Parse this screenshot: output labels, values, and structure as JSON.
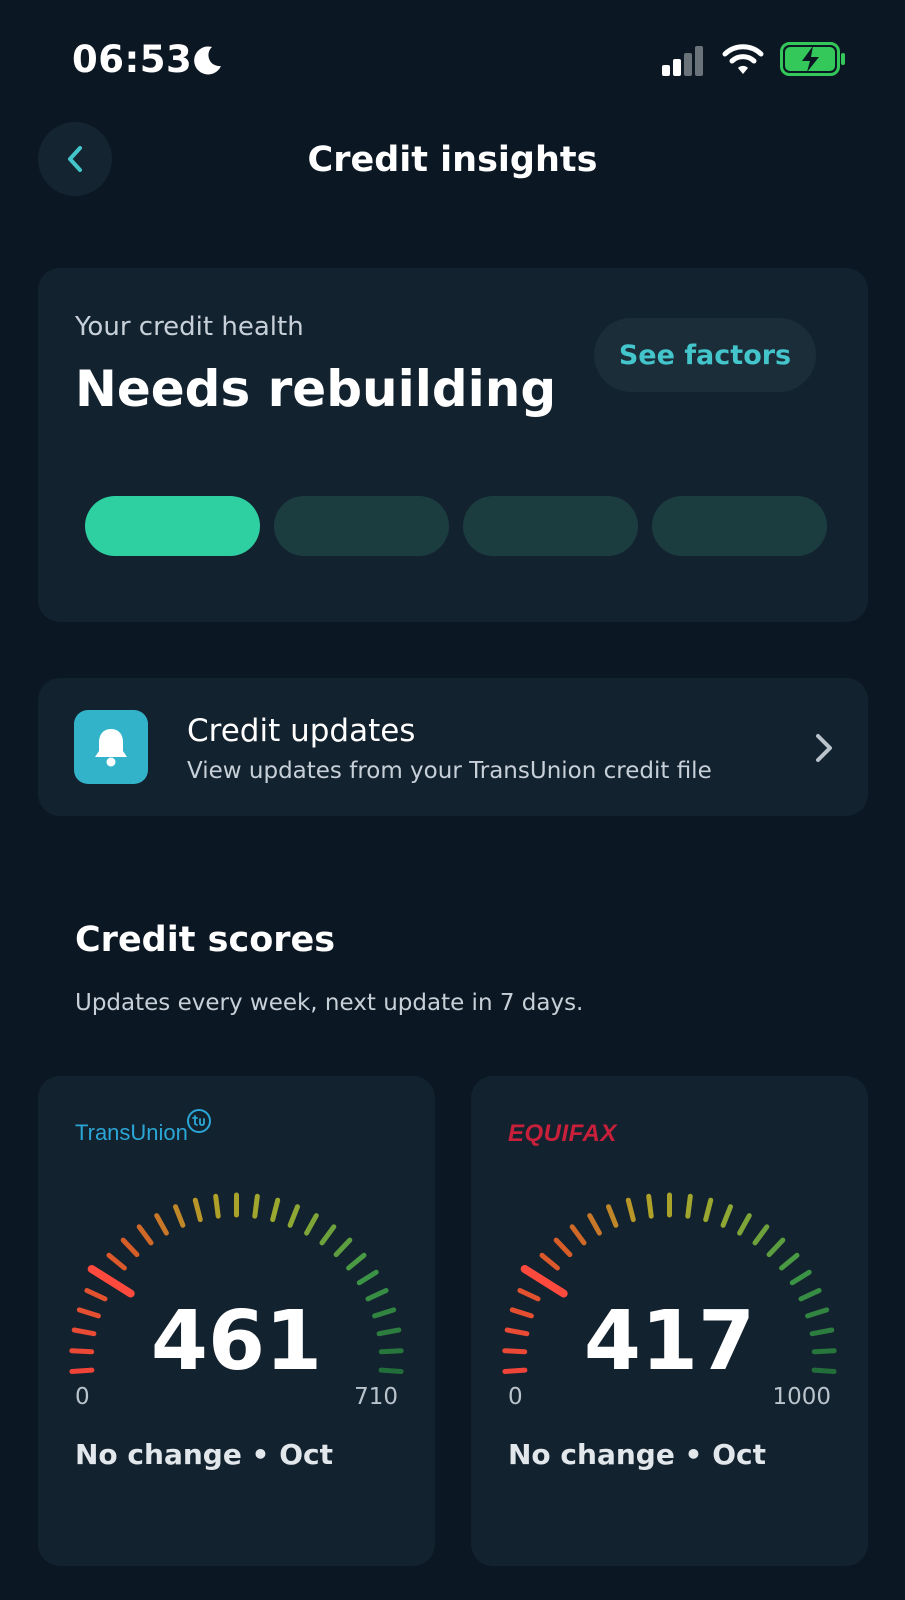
{
  "status_bar": {
    "time": "06:53",
    "icons": [
      "moon-icon",
      "signal-icon",
      "wifi-icon",
      "battery-charging-icon"
    ],
    "battery_color": "#34c759"
  },
  "header": {
    "title": "Credit insights",
    "back_icon": "chevron-left-icon"
  },
  "credit_health": {
    "label": "Your credit health",
    "status": "Needs rebuilding",
    "factors_button": "See factors",
    "level": 1,
    "levels_total": 4,
    "active_color": "#2ecfa0",
    "inactive_color": "#1b3d40"
  },
  "credit_updates": {
    "icon": "bell-icon",
    "title": "Credit updates",
    "subtitle": "View updates from your TransUnion credit file"
  },
  "credit_scores": {
    "title": "Credit scores",
    "subtitle": "Updates every week, next update in 7 days.",
    "bureaus": [
      {
        "name": "TransUnion",
        "score": "461",
        "min": "0",
        "max": "710",
        "score_fraction": 0.2,
        "change": "No change • Oct"
      },
      {
        "name": "EQUIFAX",
        "score": "417",
        "min": "0",
        "max": "1000",
        "score_fraction": 0.18,
        "change": "No change • Oct"
      }
    ]
  },
  "accent_color": "#43c5cb"
}
